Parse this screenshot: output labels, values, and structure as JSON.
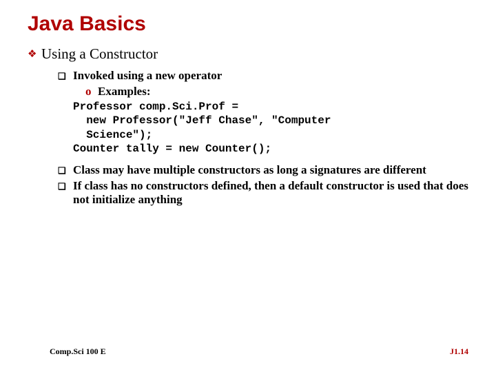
{
  "title": "Java Basics",
  "heading": "Using a Constructor",
  "items": [
    {
      "text": "Invoked using a new operator"
    }
  ],
  "examples_label": "Examples:",
  "code": "Professor comp.Sci.Prof =\n  new Professor(\"Jeff Chase\", \"Computer\n  Science\");\nCounter tally = new Counter();",
  "tail_items": [
    "Class may have multiple constructors as long a signatures are different",
    "If class has no constructors defined, then a default constructor is used that does not initialize anything"
  ],
  "footer": {
    "left": "Comp.Sci 100 E",
    "right": "J1.14"
  }
}
